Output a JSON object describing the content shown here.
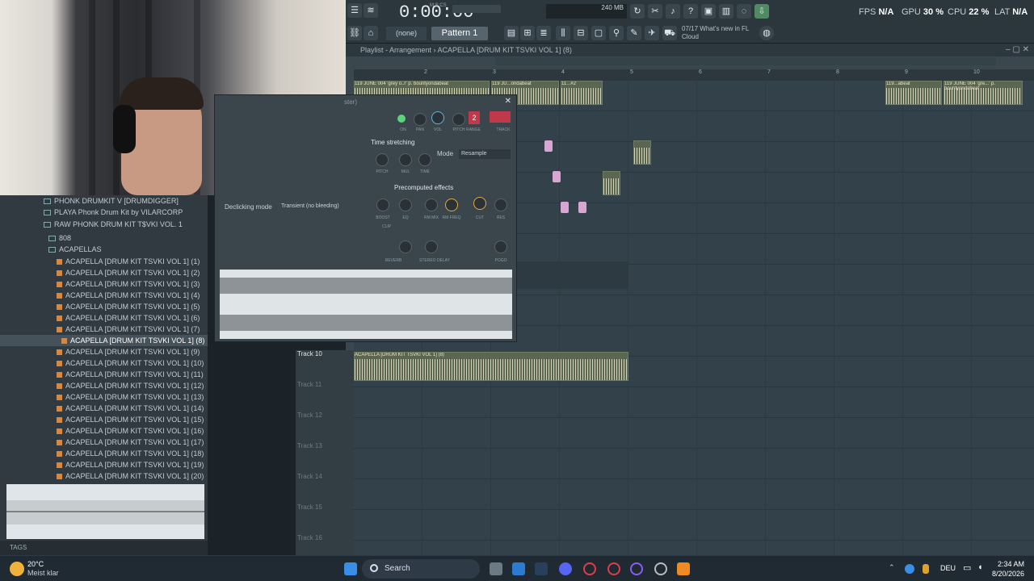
{
  "toolbar": {
    "time": "0:00:00",
    "time_label": "M:S:CS",
    "memory": "240 MB",
    "stats": {
      "fps_label": "FPS",
      "fps": "N/A",
      "gpu_label": "GPU",
      "gpu": "30 %",
      "cpu_label": "CPU",
      "cpu": "22 %",
      "lat_label": "LAT",
      "lat": "N/A"
    },
    "none_select": "(none)",
    "pattern": "Pattern 1",
    "news_count": "07/17",
    "news_text": "What's new in FL",
    "news_text2": "Cloud"
  },
  "playlist": {
    "title": "Playlist - Arrangement › ACAPELLA [DRUM KIT TSVKI VOL 1] (8)",
    "ruler": [
      "2",
      "3",
      "4",
      "5",
      "6",
      "7",
      "8",
      "9",
      "10"
    ],
    "clips_top": [
      "119 JUNE 004 'grey o..r' p. bountyondabeat",
      "119 JU...ondabeat",
      "11...#2",
      "119...abeat",
      "119 JUNE 004 'gre...' p. bountyondabeat"
    ],
    "clip_track10": "ACAPELLA [DRUM KIT TSVKI VOL 1] (8)",
    "tracks": [
      "Track 10",
      "Track 11",
      "Track 12",
      "Track 13",
      "Track 14",
      "Track 15",
      "Track 16"
    ]
  },
  "browser": {
    "items": [
      "PHONK DRUMKIT V [DRUMDIGGER]",
      "PLAYA Phonk Drum Kit by VILARCORP",
      "RAW PHONK DRUM KIT T$VKI VOL. 1",
      "808",
      "ACAPELLAS",
      "ACAPELLA [DRUM KIT TSVKI VOL 1] (1)",
      "ACAPELLA [DRUM KIT TSVKI VOL 1] (2)",
      "ACAPELLA [DRUM KIT TSVKI VOL 1] (3)",
      "ACAPELLA [DRUM KIT TSVKI VOL 1] (4)",
      "ACAPELLA [DRUM KIT TSVKI VOL 1] (5)",
      "ACAPELLA [DRUM KIT TSVKI VOL 1] (6)",
      "ACAPELLA [DRUM KIT TSVKI VOL 1] (7)",
      "ACAPELLA [DRUM KIT TSVKI VOL 1] (8)",
      "ACAPELLA [DRUM KIT TSVKI VOL 1] (9)",
      "ACAPELLA [DRUM KIT TSVKI VOL 1] (10)",
      "ACAPELLA [DRUM KIT TSVKI VOL 1] (11)",
      "ACAPELLA [DRUM KIT TSVKI VOL 1] (12)",
      "ACAPELLA [DRUM KIT TSVKI VOL 1] (13)",
      "ACAPELLA [DRUM KIT TSVKI VOL 1] (14)",
      "ACAPELLA [DRUM KIT TSVKI VOL 1] (15)",
      "ACAPELLA [DRUM KIT TSVKI VOL 1] (16)",
      "ACAPELLA [DRUM KIT TSVKI VOL 1] (17)",
      "ACAPELLA [DRUM KIT TSVKI VOL 1] (18)",
      "ACAPELLA [DRUM KIT TSVKI VOL 1] (19)",
      "ACAPELLA [DRUM KIT TSVKI VOL 1] (20)"
    ],
    "tags": "TAGS"
  },
  "sampler": {
    "title": "ster)",
    "track_num": "2",
    "track_label": "TRACK",
    "knobs_top": [
      "ON",
      "PAN",
      "VOL",
      "PITCH",
      "RANGE"
    ],
    "time_stretching": "Time stretching",
    "mode_label": "Mode",
    "mode_value": "Resample",
    "ts_knobs": [
      "PITCH",
      "MUL",
      "TIME"
    ],
    "declicking_label": "Declicking mode",
    "declicking_value": "Transient (no bleeding)",
    "precomputed": "Precomputed effects",
    "fx_knobs": [
      "BOOST",
      "EQ",
      "RM MIX",
      "RM FREQ",
      "CUT",
      "RES"
    ],
    "clip": "CLIP",
    "reverb": "REVERB",
    "delay": "STEREO DELAY",
    "pogo": "POGO"
  },
  "taskbar": {
    "temp": "20°C",
    "weather": "Meist klar",
    "search": "Search",
    "lang": "DEU",
    "time": "2:34 AM",
    "date": "8/20/2026"
  }
}
